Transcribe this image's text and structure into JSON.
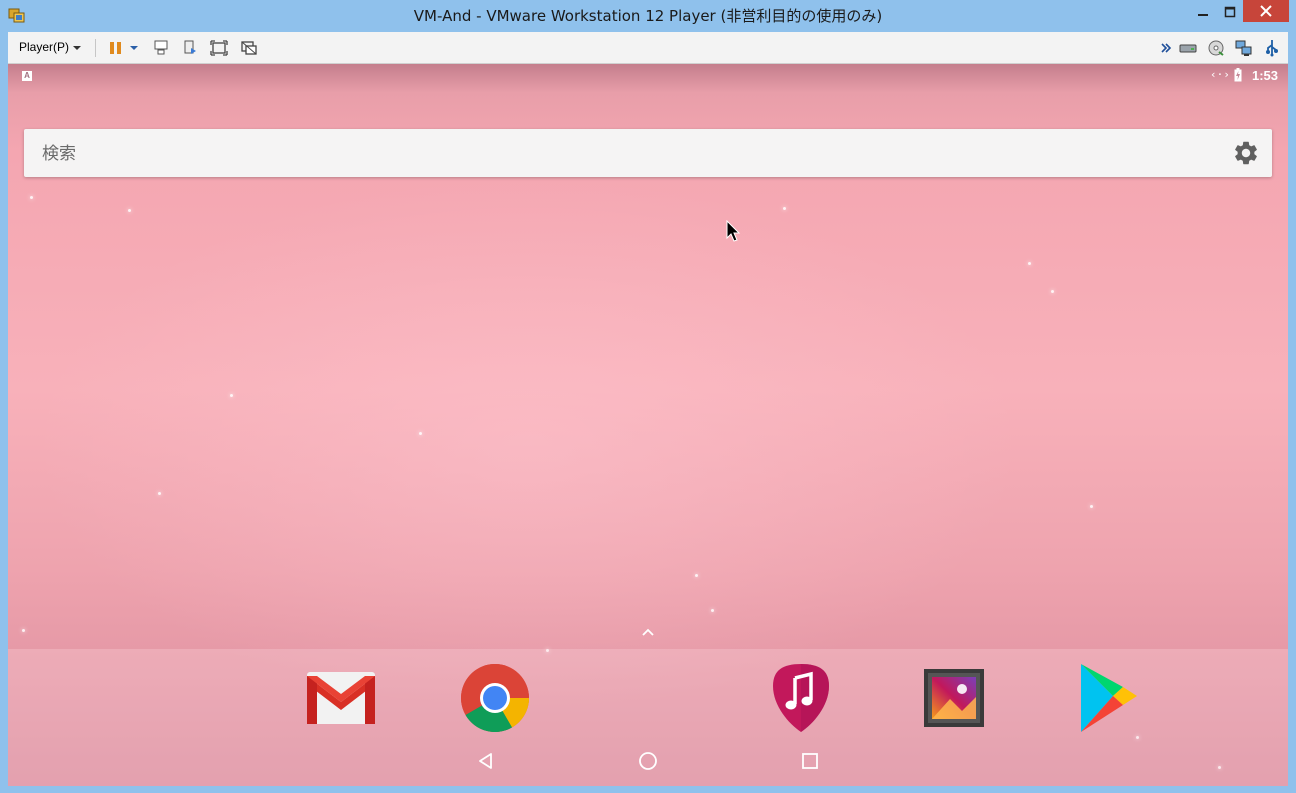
{
  "window": {
    "title": "VM-And - VMware Workstation 12 Player (非営利目的の使用のみ)",
    "controls": [
      "minimize-icon",
      "maximize-icon",
      "close-icon"
    ]
  },
  "toolbar": {
    "player_menu_label": "Player(P)",
    "icons": [
      "pause-icon",
      "dropdown-caret-icon",
      "send-ctrl-alt-del-icon",
      "removable-devices-icon",
      "fullscreen-icon",
      "unity-icon"
    ],
    "right_icons": [
      "more-chevrons-icon",
      "hard-disk-icon",
      "cd-dvd-icon",
      "network-adapter-icon",
      "usb-controller-icon"
    ]
  },
  "android": {
    "status": {
      "notification_label": "A",
      "sync_text": "‹·›",
      "time": "1:53"
    },
    "search": {
      "placeholder": "検索"
    },
    "dock_apps": [
      {
        "name": "gmail-icon"
      },
      {
        "name": "chrome-icon"
      },
      {
        "name": "music-icon"
      },
      {
        "name": "gallery-icon"
      },
      {
        "name": "play-store-icon"
      }
    ],
    "nav": [
      "back-icon",
      "home-icon",
      "recents-icon"
    ]
  },
  "colors": {
    "titlebar": "#8fc1ec",
    "close_button": "#c7453a",
    "wallpaper": "#f8b1ba",
    "search_bg": "#f5f4f4"
  }
}
